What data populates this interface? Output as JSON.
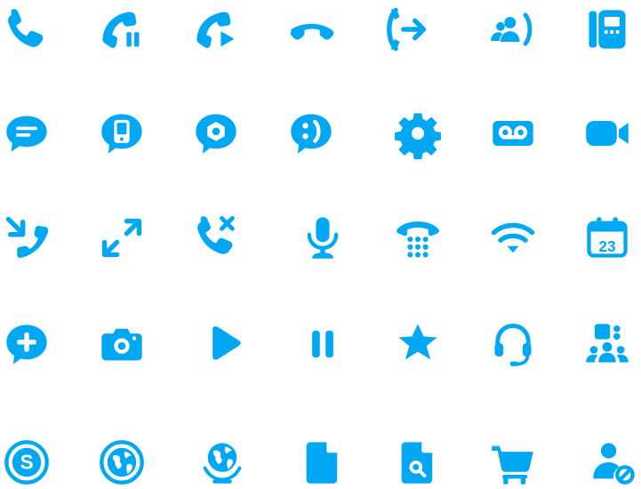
{
  "theme": {
    "icon_color": "#00a8f3",
    "background": "#ffffff"
  },
  "icons": [
    "phone-icon",
    "call-hold-icon",
    "call-resume-icon",
    "hang-up-icon",
    "call-transfer-icon",
    "group-call-icon",
    "desk-phone-icon",
    "chat-icon",
    "mobile-message-icon",
    "location-message-icon",
    "emoticon-message-icon",
    "settings-gear-icon",
    "voicemail-icon",
    "video-camera-icon",
    "incoming-call-icon",
    "expand-arrows-icon",
    "call-missed-icon",
    "microphone-icon",
    "dialpad-phone-icon",
    "wifi-icon",
    "calendar-icon",
    "add-message-icon",
    "camera-icon",
    "play-icon",
    "pause-icon",
    "star-icon",
    "headset-icon",
    "meeting-icon",
    "skype-logo-icon",
    "globe-circle-icon",
    "globe-icon",
    "document-icon",
    "document-search-icon",
    "shopping-cart-icon",
    "block-contact-icon"
  ]
}
